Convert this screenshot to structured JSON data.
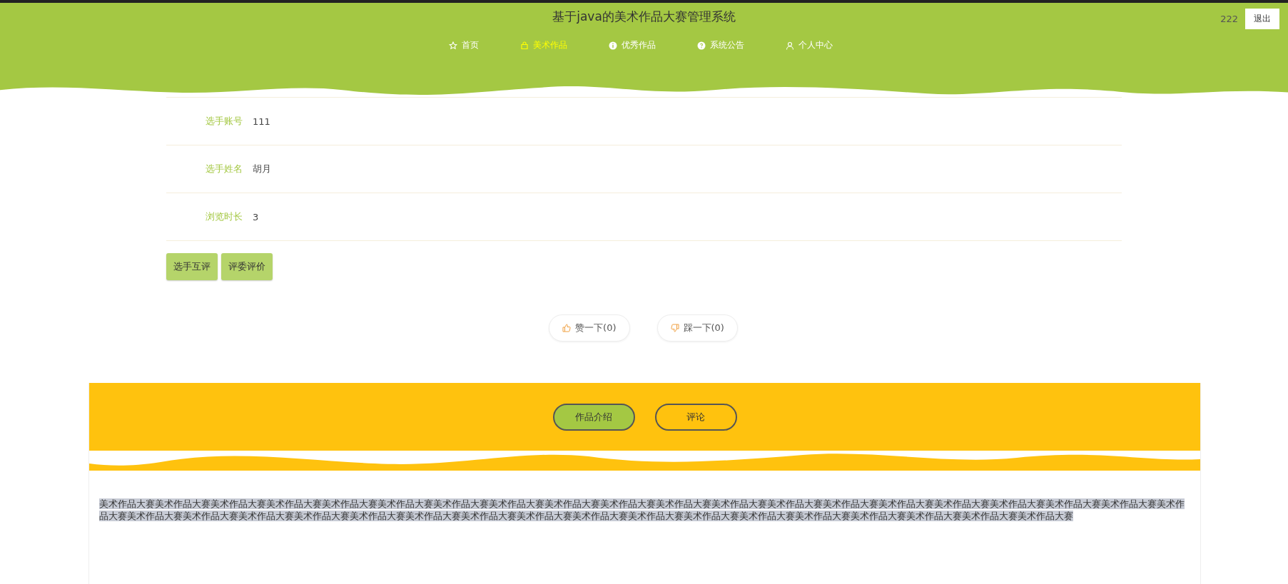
{
  "header": {
    "title": "基于java的美术作品大赛管理系统",
    "username": "222",
    "logout": "退出"
  },
  "nav": [
    {
      "label": "首页",
      "selected": false
    },
    {
      "label": "美术作品",
      "selected": true
    },
    {
      "label": "优秀作品",
      "selected": false
    },
    {
      "label": "系统公告",
      "selected": false
    },
    {
      "label": "个人中心",
      "selected": false
    }
  ],
  "details": [
    {
      "label": "选手账号",
      "value": "111"
    },
    {
      "label": "选手姓名",
      "value": "胡月"
    },
    {
      "label": "浏览时长",
      "value": "3"
    }
  ],
  "actions": [
    "选手互评",
    "评委评价"
  ],
  "votes": [
    {
      "kind": "up",
      "label": "赞一下(0)"
    },
    {
      "kind": "down",
      "label": "踩一下(0)"
    }
  ],
  "tabs": [
    {
      "label": "作品介绍",
      "selected": true
    },
    {
      "label": "评论",
      "selected": false
    }
  ],
  "description": "美术作品大赛美术作品大赛美术作品大赛美术作品大赛美术作品大赛美术作品大赛美术作品大赛美术作品大赛美术作品大赛美术作品大赛美术作品大赛美术作品大赛美术作品大赛美术作品大赛美术作品大赛美术作品大赛美术作品大赛美术作品大赛美术作品大赛美术作品大赛美术作品大赛美术作品大赛美术作品大赛美术作品大赛美术作品大赛美术作品大赛美术作品大赛美术作品大赛美术作品大赛美术作品大赛美术作品大赛美术作品大赛美术作品大赛美术作品大赛美术作品大赛美术作品大赛美术作品大赛"
}
